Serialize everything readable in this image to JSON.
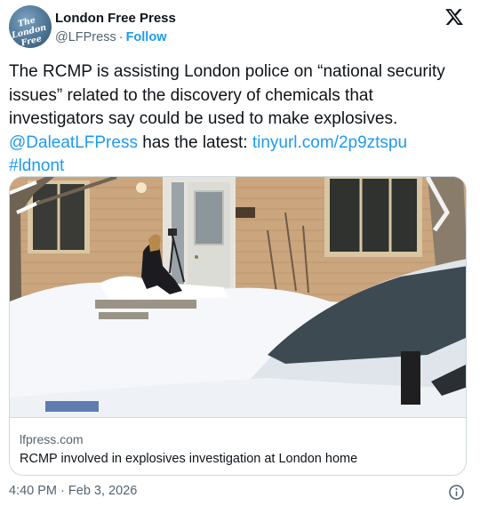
{
  "account": {
    "display_name": "London Free Press",
    "handle": "@LFPress",
    "separator": "·",
    "follow_label": "Follow",
    "avatar_text_line1": "The London",
    "avatar_text_line2": "Free Press"
  },
  "post": {
    "text_part1": "The RCMP is assisting London police on “national security issues” related to the discovery of chemicals that investigators say could be used to make explosives. ",
    "mention": "@DaleatLFPress",
    "text_part2": " has the latest: ",
    "link": "tinyurl.com/2p9ztspu",
    "hashtag": "#ldnont"
  },
  "card": {
    "image_icon": "photo-of-snowy-house-with-investigator",
    "domain": "lfpress.com",
    "title": "RCMP involved in explosives investigation at London home"
  },
  "meta": {
    "time": "4:40 PM",
    "separator": "·",
    "date": "Feb 3, 2026"
  },
  "icons": {
    "brand": "x-logo-icon",
    "info": "info-icon"
  },
  "colors": {
    "link": "#1d9bf0",
    "secondary_text": "#536471",
    "border": "#cfd9de",
    "text": "#0f1419"
  }
}
